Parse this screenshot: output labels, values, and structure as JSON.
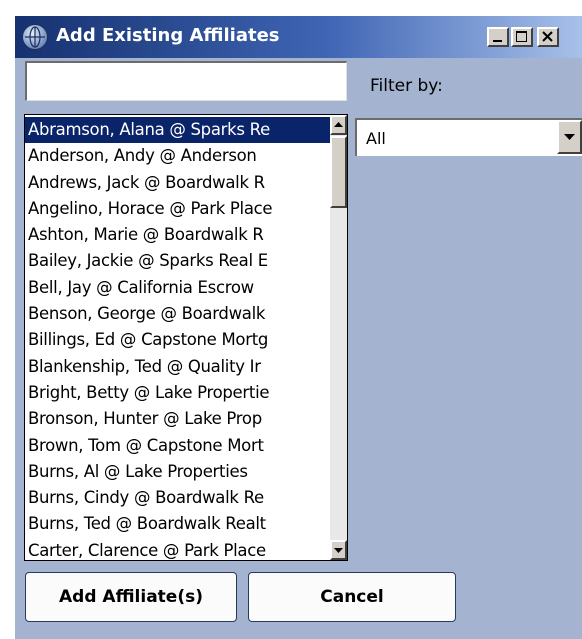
{
  "window": {
    "title": "Add Existing Affiliates",
    "app_icon": "globe-icon",
    "controls": [
      "minimize-icon",
      "maximize-icon",
      "close-icon"
    ]
  },
  "search": {
    "value": ""
  },
  "filter": {
    "label": "Filter by:",
    "selected": "All"
  },
  "affiliates": {
    "selected_index": 0,
    "items": [
      "Abramson, Alana @ Sparks Re",
      "Anderson, Andy @ Anderson",
      "Andrews, Jack @ Boardwalk R",
      "Angelino, Horace @ Park Place",
      "Ashton, Marie @ Boardwalk R",
      "Bailey, Jackie @ Sparks Real E",
      "Bell, Jay @ California Escrow",
      "Benson, George @ Boardwalk",
      "Billings, Ed @ Capstone Mortg",
      "Blankenship, Ted @ Quality Ir",
      "Bright, Betty @ Lake Propertie",
      "Bronson, Hunter @ Lake Prop",
      "Brown, Tom @ Capstone Mort",
      "Burns, Al @ Lake Properties",
      "Burns, Cindy @ Boardwalk Re",
      "Burns, Ted @ Boardwalk Realt",
      "Carter, Clarence @ Park Place"
    ]
  },
  "buttons": {
    "add": "Add Affiliate(s)",
    "cancel": "Cancel"
  },
  "colors": {
    "title_bar_start": "#16316f",
    "title_bar_end": "#a8c1ea",
    "dialog_background": "#a4b3cf",
    "selection": "#0a246a"
  }
}
